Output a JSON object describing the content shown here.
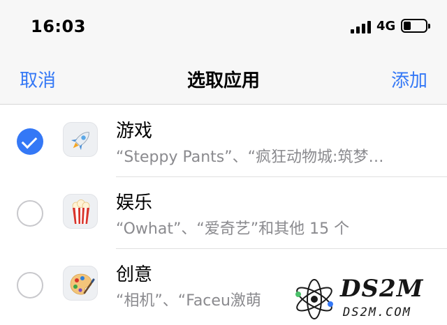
{
  "status_bar": {
    "time": "16:03",
    "network": "4G",
    "signal_bars": 4,
    "battery_level": 0.25
  },
  "nav": {
    "cancel_label": "取消",
    "title": "选取应用",
    "add_label": "添加"
  },
  "categories": [
    {
      "title": "游戏",
      "subtitle": "“Steppy Pants”、“疯狂动物城:筑梦…",
      "selected": true,
      "icon": "rocket-icon"
    },
    {
      "title": "娱乐",
      "subtitle": "“Owhat”、“爱奇艺”和其他 15 个",
      "selected": false,
      "icon": "popcorn-icon"
    },
    {
      "title": "创意",
      "subtitle": "“相机”、“Faceu激萌",
      "selected": false,
      "icon": "palette-icon"
    }
  ],
  "watermark": {
    "text": "DS2M",
    "url": "DS2M.COM"
  },
  "colors": {
    "accent": "#3478f6",
    "bar_background": "#f7f7f7",
    "secondary_text": "#8a8a8e"
  }
}
